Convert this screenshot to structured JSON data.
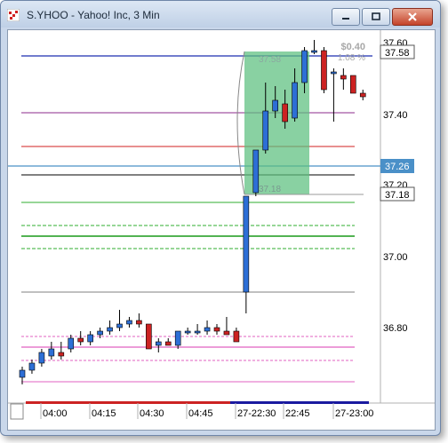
{
  "window": {
    "title": "S.YHOO - Yahoo! Inc, 3 Min",
    "icons": [
      "app-chart-icon",
      "minimize-icon",
      "maximize-icon",
      "close-icon"
    ]
  },
  "price_axis": {
    "ticks": [
      "37.60",
      "37.40",
      "37.20",
      "37.00",
      "36.80"
    ],
    "markers": [
      {
        "label": "37.58",
        "style": "box"
      },
      {
        "label": "37.26",
        "style": "highlight"
      },
      {
        "label": "37.18",
        "style": "box"
      }
    ]
  },
  "time_axis": {
    "ticks": [
      "04:00",
      "04:15",
      "04:30",
      "04:45",
      "27-22:30",
      "22:45",
      "27-23:00"
    ]
  },
  "measure_tool": {
    "start_value": "37.58",
    "end_value": "37.18",
    "change": "$0.40",
    "percent": "1.08 %"
  },
  "colors": {
    "up": "#2d6fd6",
    "down": "#cc2222",
    "measure_fill": "#5cbf7e",
    "highlight_line": "#4a90c8"
  },
  "chart_data": {
    "type": "candlestick",
    "ylim": [
      36.67,
      37.62
    ],
    "series": [
      {
        "o": 36.66,
        "h": 36.69,
        "l": 36.64,
        "c": 36.68
      },
      {
        "o": 36.68,
        "h": 36.71,
        "l": 36.67,
        "c": 36.7
      },
      {
        "o": 36.7,
        "h": 36.74,
        "l": 36.69,
        "c": 36.73
      },
      {
        "o": 36.72,
        "h": 36.76,
        "l": 36.71,
        "c": 36.74
      },
      {
        "o": 36.73,
        "h": 36.76,
        "l": 36.71,
        "c": 36.72
      },
      {
        "o": 36.74,
        "h": 36.78,
        "l": 36.73,
        "c": 36.77
      },
      {
        "o": 36.77,
        "h": 36.79,
        "l": 36.75,
        "c": 36.76
      },
      {
        "o": 36.76,
        "h": 36.79,
        "l": 36.75,
        "c": 36.78
      },
      {
        "o": 36.78,
        "h": 36.8,
        "l": 36.77,
        "c": 36.79
      },
      {
        "o": 36.79,
        "h": 36.82,
        "l": 36.78,
        "c": 36.8
      },
      {
        "o": 36.8,
        "h": 36.85,
        "l": 36.79,
        "c": 36.81
      },
      {
        "o": 36.81,
        "h": 36.83,
        "l": 36.8,
        "c": 36.82
      },
      {
        "o": 36.82,
        "h": 36.84,
        "l": 36.8,
        "c": 36.81
      },
      {
        "o": 36.81,
        "h": 36.81,
        "l": 36.74,
        "c": 36.74
      },
      {
        "o": 36.75,
        "h": 36.77,
        "l": 36.73,
        "c": 36.76
      },
      {
        "o": 36.76,
        "h": 36.77,
        "l": 36.75,
        "c": 36.75
      },
      {
        "o": 36.75,
        "h": 36.79,
        "l": 36.74,
        "c": 36.79
      },
      {
        "o": 36.79,
        "h": 36.8,
        "l": 36.78,
        "c": 36.79
      },
      {
        "o": 36.79,
        "h": 36.81,
        "l": 36.78,
        "c": 36.79
      },
      {
        "o": 36.79,
        "h": 36.82,
        "l": 36.78,
        "c": 36.8
      },
      {
        "o": 36.8,
        "h": 36.81,
        "l": 36.78,
        "c": 36.79
      },
      {
        "o": 36.79,
        "h": 36.83,
        "l": 36.78,
        "c": 36.78
      },
      {
        "o": 36.79,
        "h": 36.8,
        "l": 36.76,
        "c": 36.76
      },
      {
        "o": 36.9,
        "h": 37.17,
        "l": 36.84,
        "c": 37.17
      },
      {
        "o": 37.18,
        "h": 37.3,
        "l": 37.17,
        "c": 37.3
      },
      {
        "o": 37.3,
        "h": 37.49,
        "l": 37.29,
        "c": 37.41
      },
      {
        "o": 37.41,
        "h": 37.48,
        "l": 37.39,
        "c": 37.44
      },
      {
        "o": 37.43,
        "h": 37.47,
        "l": 37.36,
        "c": 37.38
      },
      {
        "o": 37.39,
        "h": 37.53,
        "l": 37.38,
        "c": 37.49
      },
      {
        "o": 37.49,
        "h": 37.59,
        "l": 37.46,
        "c": 37.58
      },
      {
        "o": 37.58,
        "h": 37.61,
        "l": 37.57,
        "c": 37.58
      },
      {
        "o": 37.58,
        "h": 37.59,
        "l": 37.46,
        "c": 37.47
      },
      {
        "o": 37.52,
        "h": 37.53,
        "l": 37.38,
        "c": 37.52
      },
      {
        "o": 37.51,
        "h": 37.53,
        "l": 37.47,
        "c": 37.5
      },
      {
        "o": 37.51,
        "h": 37.51,
        "l": 37.46,
        "c": 37.46
      },
      {
        "o": 37.46,
        "h": 37.47,
        "l": 37.44,
        "c": 37.45
      }
    ]
  }
}
